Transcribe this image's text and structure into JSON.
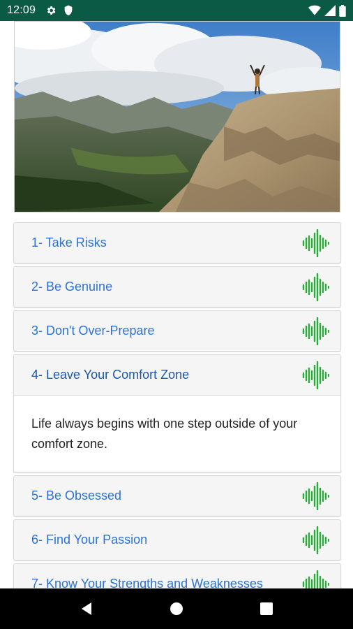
{
  "status_bar": {
    "time": "12:09",
    "background": "#0a5a45",
    "left_icons": [
      "gear-icon",
      "shield-icon"
    ],
    "right_icons": [
      "wifi-icon",
      "signal-icon",
      "battery-icon"
    ]
  },
  "hero_image": {
    "description_icon": "mountain-photo"
  },
  "accent_color": "#2a72d6",
  "sound_icon_color": "#2daa3c",
  "items": [
    {
      "label": "1- Take Risks"
    },
    {
      "label": "2- Be Genuine"
    },
    {
      "label": "3- Don't Over-Prepare"
    },
    {
      "label": "4- Leave Your Comfort Zone",
      "expanded": true,
      "body": "Life always begins with one step outside of your comfort zone."
    },
    {
      "label": "5- Be Obsessed"
    },
    {
      "label": "6- Find Your Passion"
    },
    {
      "label": "7- Know Your Strengths and Weaknesses"
    }
  ],
  "nav_bar": {
    "buttons": [
      "back-icon",
      "home-icon",
      "recents-icon"
    ]
  }
}
